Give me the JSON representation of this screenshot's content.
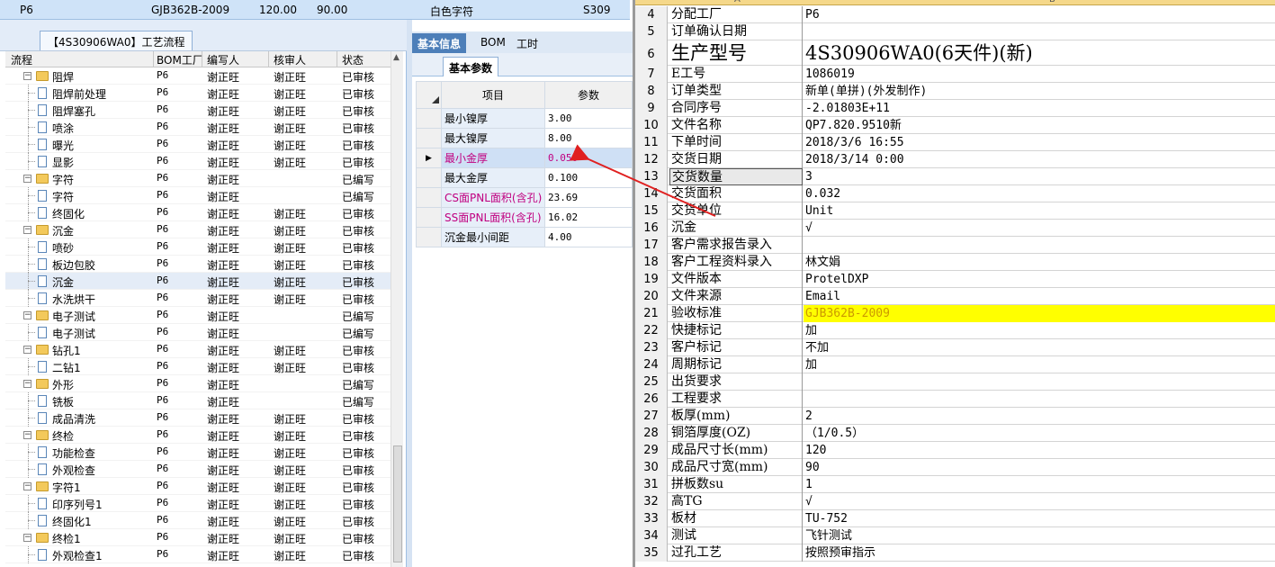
{
  "topbar": {
    "c1": "P6",
    "c2": "GJB362B-2009",
    "c3": "120.00",
    "c4": "90.00",
    "c5": "白色字符",
    "c6": "S309"
  },
  "left_panel": {
    "tab": "【4S30906WA0】工艺流程",
    "headers": [
      "流程",
      "BOM工厂",
      "编写人",
      "核审人",
      "状态"
    ],
    "rows": [
      {
        "level": 0,
        "name": "阻焊",
        "bom": "P6",
        "writer": "谢正旺",
        "reviewer": "谢正旺",
        "status": "已审核"
      },
      {
        "level": 1,
        "name": "阻焊前处理",
        "bom": "P6",
        "writer": "谢正旺",
        "reviewer": "谢正旺",
        "status": "已审核"
      },
      {
        "level": 1,
        "name": "阻焊塞孔",
        "bom": "P6",
        "writer": "谢正旺",
        "reviewer": "谢正旺",
        "status": "已审核"
      },
      {
        "level": 1,
        "name": "喷涂",
        "bom": "P6",
        "writer": "谢正旺",
        "reviewer": "谢正旺",
        "status": "已审核"
      },
      {
        "level": 1,
        "name": "曝光",
        "bom": "P6",
        "writer": "谢正旺",
        "reviewer": "谢正旺",
        "status": "已审核"
      },
      {
        "level": 1,
        "name": "显影",
        "bom": "P6",
        "writer": "谢正旺",
        "reviewer": "谢正旺",
        "status": "已审核"
      },
      {
        "level": 0,
        "name": "字符",
        "bom": "P6",
        "writer": "谢正旺",
        "reviewer": "",
        "status": "已编写"
      },
      {
        "level": 1,
        "name": "字符",
        "bom": "P6",
        "writer": "谢正旺",
        "reviewer": "",
        "status": "已编写"
      },
      {
        "level": 1,
        "name": "终固化",
        "bom": "P6",
        "writer": "谢正旺",
        "reviewer": "谢正旺",
        "status": "已审核"
      },
      {
        "level": 0,
        "name": "沉金",
        "bom": "P6",
        "writer": "谢正旺",
        "reviewer": "谢正旺",
        "status": "已审核"
      },
      {
        "level": 1,
        "name": "喷砂",
        "bom": "P6",
        "writer": "谢正旺",
        "reviewer": "谢正旺",
        "status": "已审核"
      },
      {
        "level": 1,
        "name": "板边包胶",
        "bom": "P6",
        "writer": "谢正旺",
        "reviewer": "谢正旺",
        "status": "已审核"
      },
      {
        "level": 1,
        "name": "沉金",
        "bom": "P6",
        "writer": "谢正旺",
        "reviewer": "谢正旺",
        "status": "已审核",
        "selected": true
      },
      {
        "level": 1,
        "name": "水洗烘干",
        "bom": "P6",
        "writer": "谢正旺",
        "reviewer": "谢正旺",
        "status": "已审核"
      },
      {
        "level": 0,
        "name": "电子测试",
        "bom": "P6",
        "writer": "谢正旺",
        "reviewer": "",
        "status": "已编写"
      },
      {
        "level": 1,
        "name": "电子测试",
        "bom": "P6",
        "writer": "谢正旺",
        "reviewer": "",
        "status": "已编写"
      },
      {
        "level": 0,
        "name": "钻孔1",
        "bom": "P6",
        "writer": "谢正旺",
        "reviewer": "谢正旺",
        "status": "已审核"
      },
      {
        "level": 1,
        "name": "二钻1",
        "bom": "P6",
        "writer": "谢正旺",
        "reviewer": "谢正旺",
        "status": "已审核"
      },
      {
        "level": 0,
        "name": "外形",
        "bom": "P6",
        "writer": "谢正旺",
        "reviewer": "",
        "status": "已编写"
      },
      {
        "level": 1,
        "name": "铣板",
        "bom": "P6",
        "writer": "谢正旺",
        "reviewer": "",
        "status": "已编写"
      },
      {
        "level": 1,
        "name": "成品清洗",
        "bom": "P6",
        "writer": "谢正旺",
        "reviewer": "谢正旺",
        "status": "已审核"
      },
      {
        "level": 0,
        "name": "终检",
        "bom": "P6",
        "writer": "谢正旺",
        "reviewer": "谢正旺",
        "status": "已审核"
      },
      {
        "level": 1,
        "name": "功能检查",
        "bom": "P6",
        "writer": "谢正旺",
        "reviewer": "谢正旺",
        "status": "已审核"
      },
      {
        "level": 1,
        "name": "外观检查",
        "bom": "P6",
        "writer": "谢正旺",
        "reviewer": "谢正旺",
        "status": "已审核"
      },
      {
        "level": 0,
        "name": "字符1",
        "bom": "P6",
        "writer": "谢正旺",
        "reviewer": "谢正旺",
        "status": "已审核"
      },
      {
        "level": 1,
        "name": "印序列号1",
        "bom": "P6",
        "writer": "谢正旺",
        "reviewer": "谢正旺",
        "status": "已审核"
      },
      {
        "level": 1,
        "name": "终固化1",
        "bom": "P6",
        "writer": "谢正旺",
        "reviewer": "谢正旺",
        "status": "已审核"
      },
      {
        "level": 0,
        "name": "终检1",
        "bom": "P6",
        "writer": "谢正旺",
        "reviewer": "谢正旺",
        "status": "已审核"
      },
      {
        "level": 1,
        "name": "外观检查1",
        "bom": "P6",
        "writer": "谢正旺",
        "reviewer": "谢正旺",
        "status": "已审核"
      }
    ]
  },
  "mid_panel": {
    "tabs": [
      "基本信息",
      "BOM",
      "工时"
    ],
    "subtab": "基本参数",
    "headers": [
      "项目",
      "参数"
    ],
    "rows": [
      {
        "item": "最小镍厚",
        "value": "3.00",
        "pink": false
      },
      {
        "item": "最大镍厚",
        "value": "8.00",
        "pink": false
      },
      {
        "item": "最小金厚",
        "value": "0.050",
        "pink": true,
        "focus": true
      },
      {
        "item": "最大金厚",
        "value": "0.100",
        "pink": false
      },
      {
        "item": "CS面PNL面积(含孔)",
        "value": "23.69",
        "pink": true
      },
      {
        "item": "SS面PNL面积(含孔)",
        "value": "16.02",
        "pink": true
      },
      {
        "item": "沉金最小间距",
        "value": "4.00",
        "pink": false
      }
    ]
  },
  "sheet": {
    "col_a": "A",
    "col_b": "B",
    "rows": [
      {
        "n": "4",
        "a": "分配工厂",
        "b": "P6"
      },
      {
        "n": "5",
        "a": "订单确认日期",
        "b": ""
      },
      {
        "n": "6",
        "a": "生产型号",
        "b": "4S30906WA0(6天件)(新)",
        "big": true
      },
      {
        "n": "7",
        "a": "E工号",
        "b": "1086019"
      },
      {
        "n": "8",
        "a": "订单类型",
        "b": "新单(单拼)(外发制作)"
      },
      {
        "n": "9",
        "a": "合同序号",
        "b": "-2.01803E+11"
      },
      {
        "n": "10",
        "a": "文件名称",
        "b": "QP7.820.9510新"
      },
      {
        "n": "11",
        "a": "下单时间",
        "b": "2018/3/6 16:55"
      },
      {
        "n": "12",
        "a": "交货日期",
        "b": "2018/3/14 0:00"
      },
      {
        "n": "13",
        "a": "交货数量",
        "b": "3",
        "selected": true
      },
      {
        "n": "14",
        "a": "交货面积",
        "b": "0.032"
      },
      {
        "n": "15",
        "a": "交货单位",
        "b": "Unit"
      },
      {
        "n": "16",
        "a": "沉金",
        "b": "√"
      },
      {
        "n": "17",
        "a": "客户需求报告录入",
        "b": ""
      },
      {
        "n": "18",
        "a": "客户工程资料录入",
        "b": "林文娟"
      },
      {
        "n": "19",
        "a": "文件版本",
        "b": "ProtelDXP"
      },
      {
        "n": "20",
        "a": "文件来源",
        "b": "Email"
      },
      {
        "n": "21",
        "a": "验收标准",
        "b": "GJB362B-2009",
        "yellow": true
      },
      {
        "n": "22",
        "a": "快捷标记",
        "b": "加"
      },
      {
        "n": "23",
        "a": "客户标记",
        "b": "不加"
      },
      {
        "n": "24",
        "a": "周期标记",
        "b": "加"
      },
      {
        "n": "25",
        "a": "出货要求",
        "b": ""
      },
      {
        "n": "26",
        "a": "工程要求",
        "b": ""
      },
      {
        "n": "27",
        "a": "板厚(mm)",
        "b": "2"
      },
      {
        "n": "28",
        "a": "铜箔厚度(OZ)",
        "b": "（1/0.5）"
      },
      {
        "n": "29",
        "a": "成品尺寸长(mm)",
        "b": "120"
      },
      {
        "n": "30",
        "a": "成品尺寸宽(mm)",
        "b": "90"
      },
      {
        "n": "31",
        "a": "拼板数su",
        "b": "1"
      },
      {
        "n": "32",
        "a": "高TG",
        "b": "√"
      },
      {
        "n": "33",
        "a": "板材",
        "b": "TU-752"
      },
      {
        "n": "34",
        "a": "测试",
        "b": "飞针测试"
      },
      {
        "n": "35",
        "a": "过孔工艺",
        "b": "按照预审指示"
      }
    ]
  },
  "colors": {
    "accent": "#4d7fb9",
    "highlight": "#ffff00",
    "pink": "#c00080",
    "arrow": "#e02020"
  }
}
